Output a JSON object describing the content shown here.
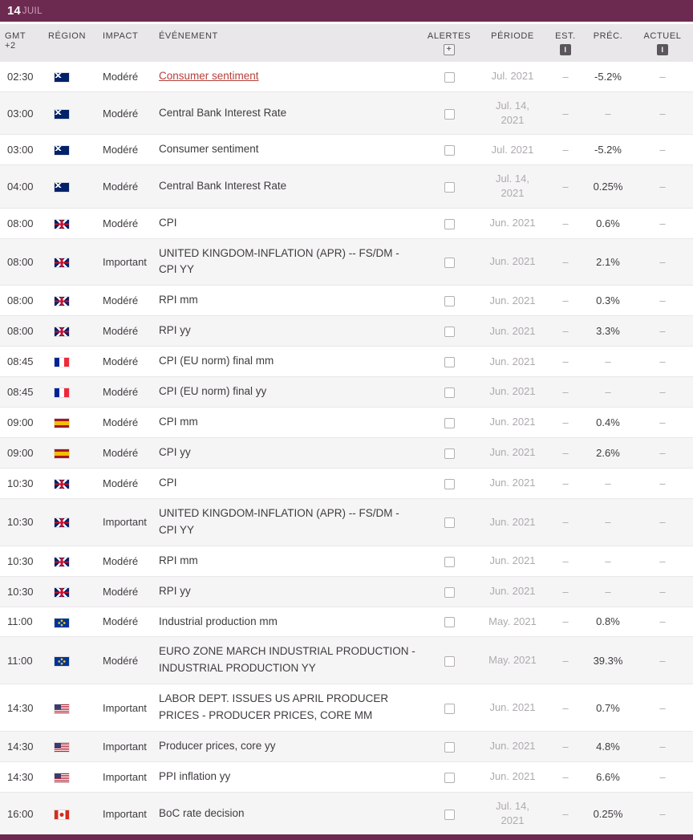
{
  "theme": {
    "accent": "#6d2a50",
    "link_red": "#b5403c",
    "header_bg": "#e9e7e9",
    "row_alt_bg": "#f6f5f6",
    "muted_text": "#aeaaae"
  },
  "date_header": {
    "day": "14",
    "month": "JUIL"
  },
  "columns": {
    "time": "GMT +2",
    "region": "RÉGION",
    "impact": "IMPACT",
    "event": "ÉVÉNEMENT",
    "alerts": "ALERTES",
    "period": "PÉRIODE",
    "est": "EST.",
    "prev": "PRÉC.",
    "actual": "ACTUEL"
  },
  "icons": {
    "alerts_add": "+",
    "info": "i"
  },
  "rows": [
    {
      "time": "02:30",
      "region": "australia",
      "impact": "Modéré",
      "event": "Consumer sentiment",
      "link": true,
      "period": "Jul. 2021",
      "est": "–",
      "prev": "-5.2%",
      "actual": "–"
    },
    {
      "time": "03:00",
      "region": "newzealand",
      "impact": "Modéré",
      "event": "Central Bank Interest Rate",
      "period": "Jul. 14, 2021",
      "est": "–",
      "prev": "–",
      "actual": "–"
    },
    {
      "time": "03:00",
      "region": "australia",
      "impact": "Modéré",
      "event": "Consumer sentiment",
      "period": "Jul. 2021",
      "est": "–",
      "prev": "-5.2%",
      "actual": "–"
    },
    {
      "time": "04:00",
      "region": "newzealand",
      "impact": "Modéré",
      "event": "Central Bank Interest Rate",
      "period": "Jul. 14, 2021",
      "est": "–",
      "prev": "0.25%",
      "actual": "–"
    },
    {
      "time": "08:00",
      "region": "uk",
      "impact": "Modéré",
      "event": "CPI",
      "period": "Jun. 2021",
      "est": "–",
      "prev": "0.6%",
      "actual": "–"
    },
    {
      "time": "08:00",
      "region": "uk",
      "impact": "Important",
      "event": "UNITED KINGDOM-INFLATION (APR) -- FS/DM - CPI YY",
      "period": "Jun. 2021",
      "est": "–",
      "prev": "2.1%",
      "actual": "–"
    },
    {
      "time": "08:00",
      "region": "uk",
      "impact": "Modéré",
      "event": "RPI mm",
      "period": "Jun. 2021",
      "est": "–",
      "prev": "0.3%",
      "actual": "–"
    },
    {
      "time": "08:00",
      "region": "uk",
      "impact": "Modéré",
      "event": "RPI yy",
      "period": "Jun. 2021",
      "est": "–",
      "prev": "3.3%",
      "actual": "–"
    },
    {
      "time": "08:45",
      "region": "france",
      "impact": "Modéré",
      "event": "CPI (EU norm) final mm",
      "period": "Jun. 2021",
      "est": "–",
      "prev": "–",
      "actual": "–"
    },
    {
      "time": "08:45",
      "region": "france",
      "impact": "Modéré",
      "event": "CPI (EU norm) final yy",
      "period": "Jun. 2021",
      "est": "–",
      "prev": "–",
      "actual": "–"
    },
    {
      "time": "09:00",
      "region": "spain",
      "impact": "Modéré",
      "event": "CPI mm",
      "period": "Jun. 2021",
      "est": "–",
      "prev": "0.4%",
      "actual": "–"
    },
    {
      "time": "09:00",
      "region": "spain",
      "impact": "Modéré",
      "event": "CPI yy",
      "period": "Jun. 2021",
      "est": "–",
      "prev": "2.6%",
      "actual": "–"
    },
    {
      "time": "10:30",
      "region": "uk",
      "impact": "Modéré",
      "event": "CPI",
      "period": "Jun. 2021",
      "est": "–",
      "prev": "–",
      "actual": "–"
    },
    {
      "time": "10:30",
      "region": "uk",
      "impact": "Important",
      "event": "UNITED KINGDOM-INFLATION (APR) -- FS/DM - CPI YY",
      "period": "Jun. 2021",
      "est": "–",
      "prev": "–",
      "actual": "–"
    },
    {
      "time": "10:30",
      "region": "uk",
      "impact": "Modéré",
      "event": "RPI mm",
      "period": "Jun. 2021",
      "est": "–",
      "prev": "–",
      "actual": "–"
    },
    {
      "time": "10:30",
      "region": "uk",
      "impact": "Modéré",
      "event": "RPI yy",
      "period": "Jun. 2021",
      "est": "–",
      "prev": "–",
      "actual": "–"
    },
    {
      "time": "11:00",
      "region": "eu",
      "impact": "Modéré",
      "event": "Industrial production mm",
      "period": "May. 2021",
      "est": "–",
      "prev": "0.8%",
      "actual": "–"
    },
    {
      "time": "11:00",
      "region": "eu",
      "impact": "Modéré",
      "event": "EURO ZONE MARCH INDUSTRIAL PRODUCTION - INDUSTRIAL PRODUCTION YY",
      "period": "May. 2021",
      "est": "–",
      "prev": "39.3%",
      "actual": "–"
    },
    {
      "time": "14:30",
      "region": "us",
      "impact": "Important",
      "event": "LABOR DEPT. ISSUES US APRIL PRODUCER PRICES - PRODUCER PRICES, CORE MM",
      "period": "Jun. 2021",
      "est": "–",
      "prev": "0.7%",
      "actual": "–"
    },
    {
      "time": "14:30",
      "region": "us",
      "impact": "Important",
      "event": "Producer prices, core yy",
      "period": "Jun. 2021",
      "est": "–",
      "prev": "4.8%",
      "actual": "–"
    },
    {
      "time": "14:30",
      "region": "us",
      "impact": "Important",
      "event": "PPI inflation yy",
      "period": "Jun. 2021",
      "est": "–",
      "prev": "6.6%",
      "actual": "–"
    },
    {
      "time": "16:00",
      "region": "canada",
      "impact": "Important",
      "event": "BoC rate decision",
      "period": "Jul. 14, 2021",
      "est": "–",
      "prev": "0.25%",
      "actual": "–"
    }
  ]
}
